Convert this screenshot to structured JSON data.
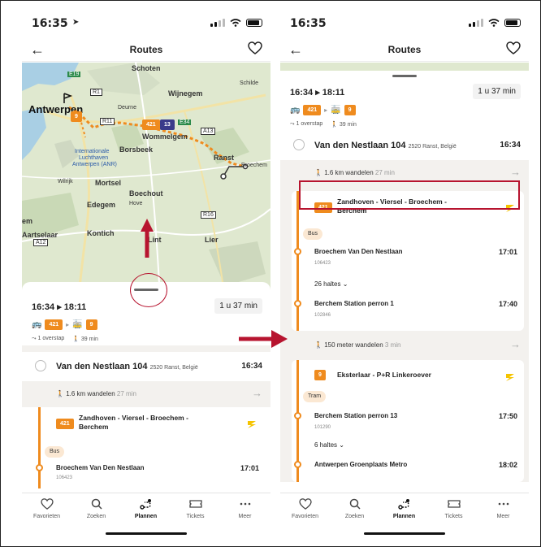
{
  "left": {
    "status_time": "16:35",
    "nav_title": "Routes",
    "map_labels": {
      "antwerpen": "Antwerpen",
      "schoten": "Schoten",
      "schilde": "Schilde",
      "wijnegem": "Wijnegem",
      "deurne": "Deurne",
      "wommelgem": "Wommelgem",
      "borsbeek": "Borsbeek",
      "internationale": "Internationale",
      "luchthaven": "Luchthaven",
      "airport": "Antwerpen (ANR)",
      "wilrijk": "Wilrijk",
      "mortsel": "Mortsel",
      "boechout": "Boechout",
      "hove": "Hove",
      "edegem": "Edegem",
      "aartselaar": "Aartselaar",
      "kontich": "Kontich",
      "lint": "Lint",
      "lier": "Lier",
      "ranst": "Ranst",
      "broechem": "Broechem",
      "em": "em",
      "r1": "R1",
      "r11": "R11",
      "r16": "R16",
      "e19": "E19",
      "e34": "E34",
      "a13": "A13",
      "a12": "A12",
      "route_badge_9": "9",
      "route_badge_421": "421",
      "route_badge_13": "13"
    },
    "summary": {
      "times": "16:34 ▸ 18:11",
      "duration": "1 u 37 min",
      "leg1": "421",
      "leg2": "9",
      "transfers": "1 overstap",
      "walk": "39 min"
    },
    "departure": {
      "name": "Van den Nestlaan 104",
      "address": "2520 Ranst, België",
      "time": "16:34"
    },
    "walk1": {
      "distance": "1.6 km wandelen",
      "duration": "27 min"
    },
    "leg": {
      "line": "421",
      "destination": "Zandhoven - Viersel - Broechem - Berchem",
      "mode": "Bus",
      "stop_name": "Broechem Van Den Nestlaan",
      "stop_code": "106423",
      "stop_time": "17:01"
    }
  },
  "right": {
    "status_time": "16:35",
    "nav_title": "Routes",
    "summary": {
      "times": "16:34 ▸ 18:11",
      "duration": "1 u 37 min",
      "leg1": "421",
      "leg2": "9",
      "transfers": "1 overstap",
      "walk": "39 min"
    },
    "departure": {
      "name": "Van den Nestlaan 104",
      "address": "2520 Ranst, België",
      "time": "16:34"
    },
    "walk1": {
      "distance": "1.6 km wandelen",
      "duration": "27 min"
    },
    "leg1": {
      "line": "421",
      "destination": "Zandhoven - Viersel - Broechem - Berchem",
      "mode": "Bus",
      "stop_name": "Broechem Van Den Nestlaan",
      "stop_code": "106423",
      "stop_time": "17:01",
      "haltes": "26 haltes",
      "end_name": "Berchem Station perron 1",
      "end_code": "102846",
      "end_time": "17:40"
    },
    "walk2": {
      "distance": "150 meter wandelen",
      "duration": "3 min"
    },
    "leg2": {
      "line": "9",
      "destination": "Eksterlaar - P+R Linkeroever",
      "mode": "Tram",
      "stop_name": "Berchem Station perron 13",
      "stop_code": "101290",
      "stop_time": "17:50",
      "haltes": "6 haltes",
      "end_name": "Antwerpen Groenplaats Metro",
      "end_time": "18:02"
    }
  },
  "tabs": [
    {
      "label": "Favorieten",
      "icon": "heart-icon"
    },
    {
      "label": "Zoeken",
      "icon": "search-icon"
    },
    {
      "label": "Plannen",
      "icon": "route-icon"
    },
    {
      "label": "Tickets",
      "icon": "ticket-icon"
    },
    {
      "label": "Meer",
      "icon": "more-icon"
    }
  ],
  "colors": {
    "accent": "#ef8b1e",
    "annotation": "#b7142f",
    "map_bg": "#dfe8cf"
  }
}
